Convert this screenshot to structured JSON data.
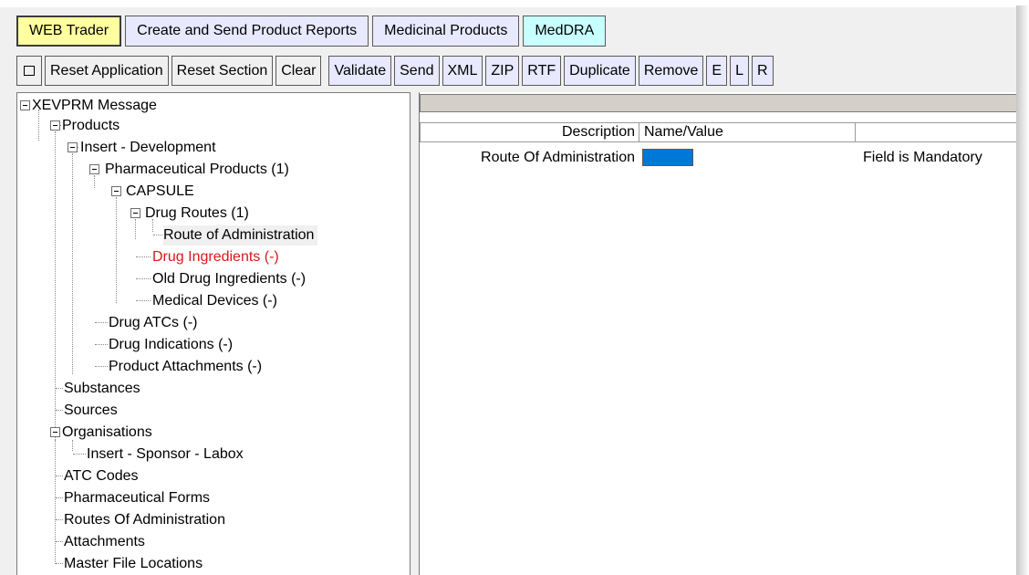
{
  "tabs": {
    "web_trader": "WEB Trader",
    "create_send": "Create and Send Product Reports",
    "medicinal": "Medicinal Products",
    "meddra": "MedDRA"
  },
  "toolbar": {
    "square_icon": "square-icon",
    "reset_application": "Reset Application",
    "reset_section": "Reset Section",
    "clear": "Clear",
    "validate": "Validate",
    "send": "Send",
    "xml": "XML",
    "zip": "ZIP",
    "rtf": "RTF",
    "duplicate": "Duplicate",
    "remove": "Remove",
    "e": "E",
    "l": "L",
    "r": "R"
  },
  "tree": {
    "root": "XEVPRM Message",
    "products": "Products",
    "insert_development": "Insert - Development",
    "pharma_products": "Pharmaceutical Products (1)",
    "capsule": "CAPSULE",
    "drug_routes": "Drug Routes (1)",
    "route_of_admin": "Route of Administration",
    "drug_ingredients": "Drug Ingredients (-)",
    "old_drug_ingredients": "Old Drug Ingredients (-)",
    "medical_devices": "Medical Devices (-)",
    "drug_atcs": "Drug ATCs (-)",
    "drug_indications": "Drug Indications (-)",
    "product_attachments": "Product Attachments (-)",
    "substances": "Substances",
    "sources": "Sources",
    "organisations": "Organisations",
    "insert_sponsor": "Insert - Sponsor - Labox",
    "atc_codes": "ATC Codes",
    "pharma_forms": "Pharmaceutical Forms",
    "routes_of_admin": "Routes Of Administration",
    "attachments": "Attachments",
    "master_file_locations": "Master File Locations"
  },
  "detail": {
    "col_description": "Description",
    "col_name_value": "Name/Value",
    "row_label": "Route Of Administration",
    "row_value_color": "#0078d7",
    "row_message": "Field is Mandatory"
  },
  "colors": {
    "active_tab": "#ffffa0",
    "tab_lavender": "#e8e8ff",
    "tab_cyan": "#c8ffff",
    "error_text": "#d81818"
  }
}
